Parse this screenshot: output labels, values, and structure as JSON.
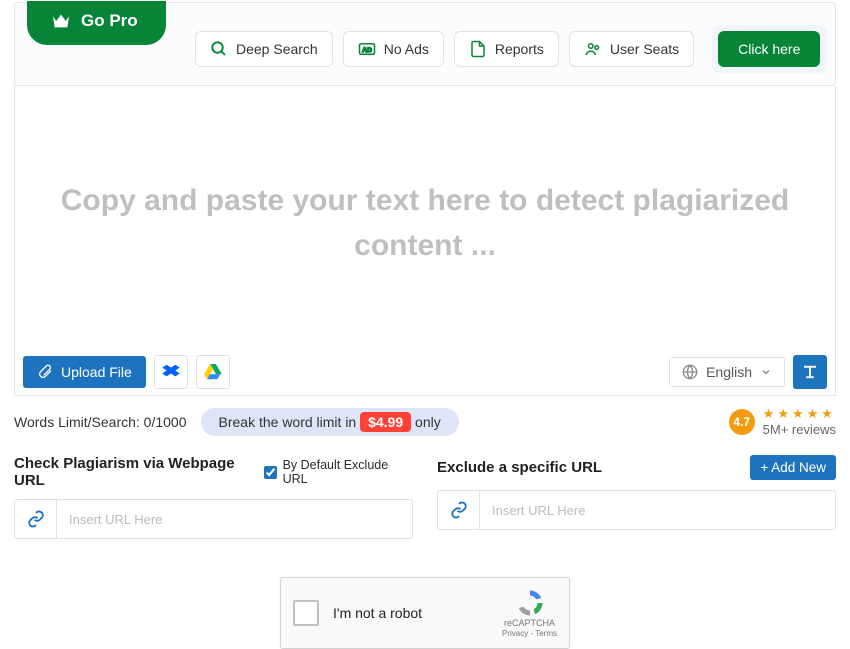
{
  "topbar": {
    "go_pro": "Go Pro",
    "features": [
      {
        "icon": "search",
        "label": "Deep Search"
      },
      {
        "icon": "no-ads",
        "label": "No Ads"
      },
      {
        "icon": "reports",
        "label": "Reports"
      },
      {
        "icon": "seats",
        "label": "User Seats"
      }
    ],
    "cta": "Click here"
  },
  "editor": {
    "placeholder": "Copy and paste your text here to detect plagiarized content ...",
    "upload": "Upload File",
    "language": "English"
  },
  "info": {
    "words_limit": "Words Limit/Search: 0/1000",
    "break_prefix": "Break the word limit in ",
    "price": "$4.99",
    "break_suffix": " only",
    "rating": "4.7",
    "reviews": "5M+ reviews"
  },
  "urls": {
    "check_label": "Check Plagiarism via Webpage URL",
    "checkbox_label": "By Default Exclude URL",
    "exclude_label": "Exclude a specific URL",
    "add_new": "+ Add New",
    "placeholder": "Insert URL Here"
  },
  "captcha": {
    "label": "I'm not a robot",
    "brand": "reCAPTCHA",
    "terms": "Privacy - Terms"
  }
}
